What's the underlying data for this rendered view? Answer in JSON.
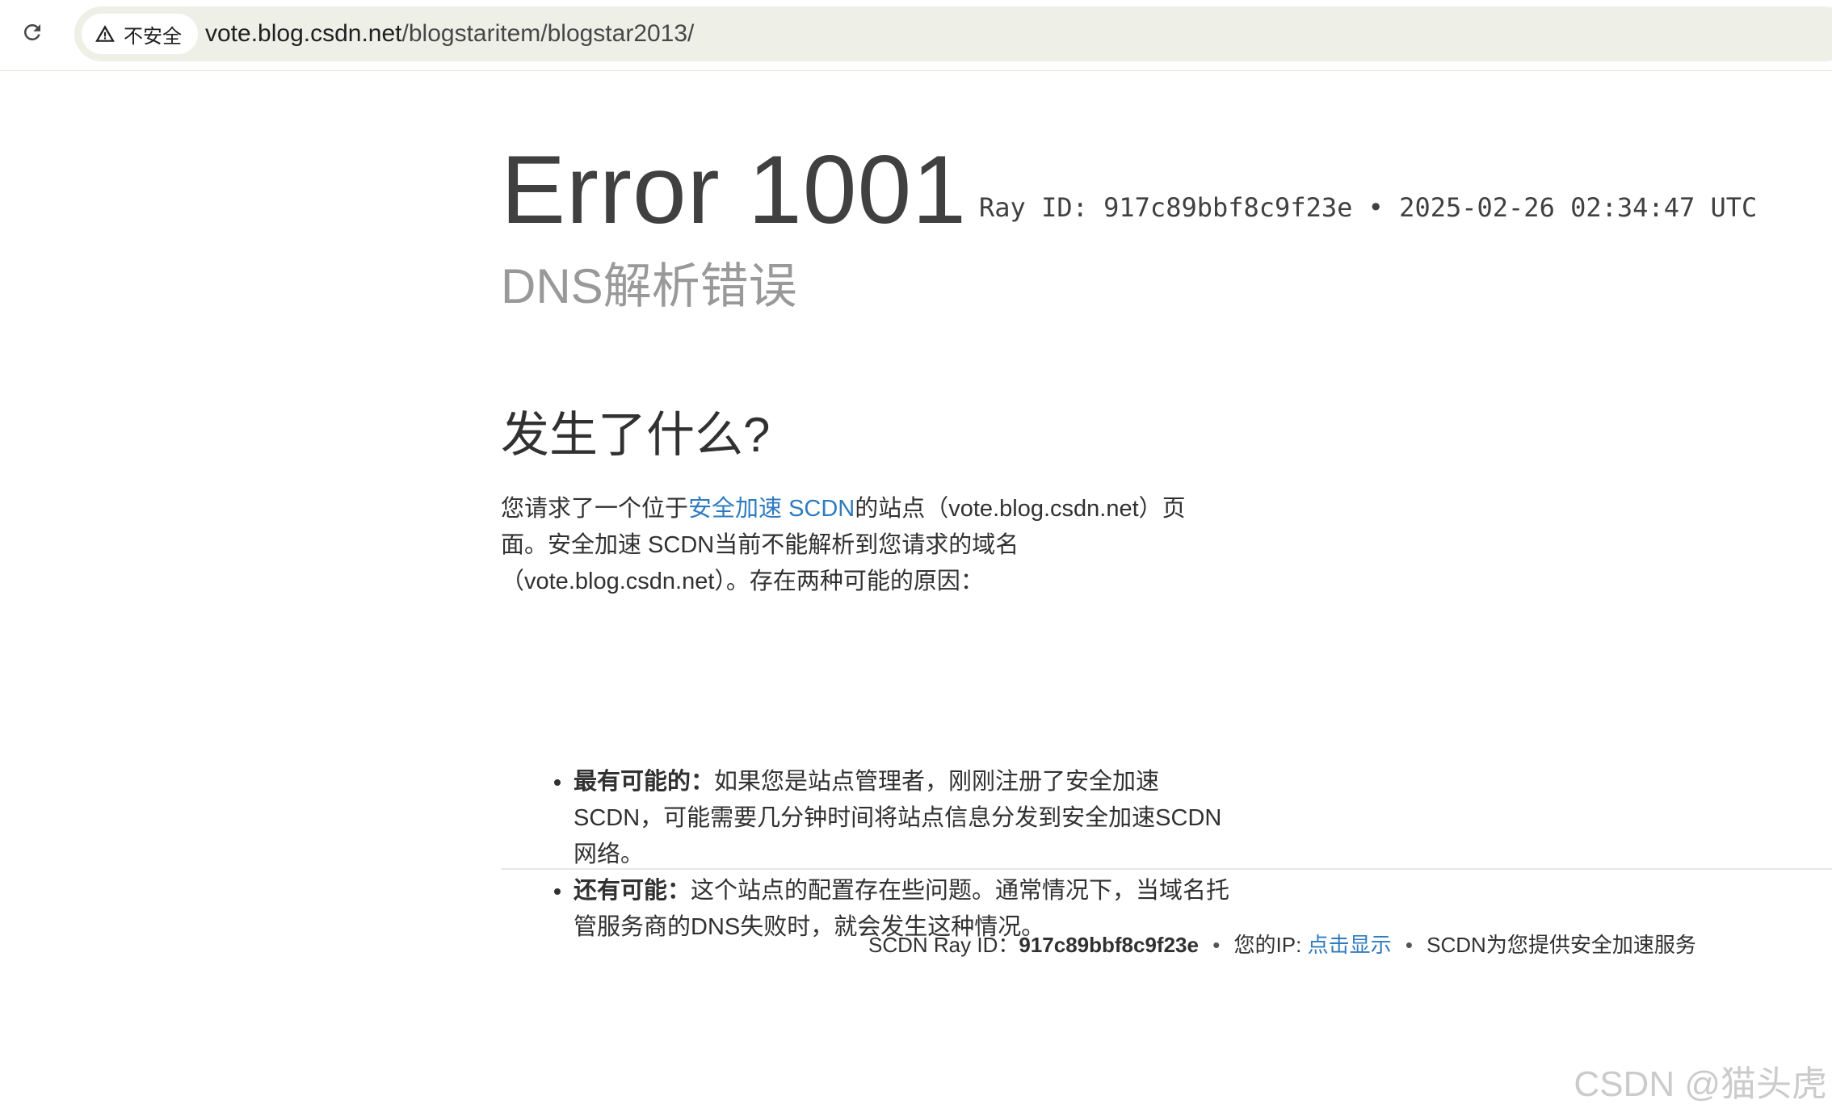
{
  "browser": {
    "security_label": "不安全",
    "url_host": "vote.blog.csdn.net",
    "url_path": "/blogstaritem/blogstar2013/"
  },
  "error": {
    "title": "Error 1001",
    "ray_header": "Ray ID: 917c89bbf8c9f23e • 2025-02-26 02:34:47 UTC",
    "subtitle": "DNS解析错误"
  },
  "what_happened": {
    "title": "发生了什么?",
    "desc_prefix": "您请求了一个位于",
    "desc_link": "安全加速 SCDN",
    "desc_suffix": "的站点（vote.blog.csdn.net）页面。安全加速 SCDN当前不能解析到您请求的域名（vote.blog.csdn.net）。存在两种可能的原因：",
    "reasons": [
      {
        "label": "最有可能的：",
        "text": "如果您是站点管理者，刚刚注册了安全加速SCDN，可能需要几分钟时间将站点信息分发到安全加速SCDN网络。"
      },
      {
        "label": "还有可能：",
        "text": "这个站点的配置存在些问题。通常情况下，当域名托管服务商的DNS失败时，就会发生这种情况。"
      }
    ]
  },
  "footer": {
    "ray_label": "SCDN Ray ID：",
    "ray_value": "917c89bbf8c9f23e",
    "separator": "•",
    "ip_label": "您的IP: ",
    "ip_link": "点击显示",
    "service": "SCDN为您提供安全加速服务"
  },
  "watermark": "CSDN @猫头虎"
}
